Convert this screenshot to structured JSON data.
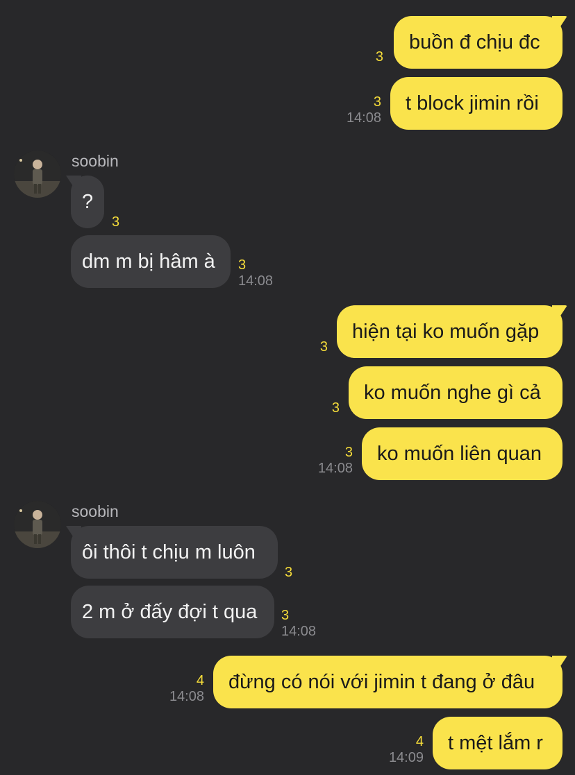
{
  "messages": [
    {
      "side": "me",
      "text": "buồn đ chịu đc",
      "count": "3",
      "time": ""
    },
    {
      "side": "me",
      "text": "t block jimin rồi",
      "count": "3",
      "time": "14:08"
    },
    {
      "side": "them",
      "sender": "soobin",
      "text": "?",
      "count": "3",
      "time": ""
    },
    {
      "side": "them",
      "text": "dm m bị hâm à",
      "count": "3",
      "time": "14:08"
    },
    {
      "side": "me",
      "text": "hiện tại ko muốn gặp",
      "count": "3",
      "time": ""
    },
    {
      "side": "me",
      "text": "ko muốn nghe gì cả",
      "count": "3",
      "time": ""
    },
    {
      "side": "me",
      "text": "ko muốn liên quan",
      "count": "3",
      "time": "14:08"
    },
    {
      "side": "them",
      "sender": "soobin",
      "text": "ôi thôi t chịu m luôn",
      "count": "3",
      "time": ""
    },
    {
      "side": "them",
      "text": "2 m ở đấy đợi t qua",
      "count": "3",
      "time": "14:08"
    },
    {
      "side": "me",
      "text": "đừng có nói với jimin t đang ở đâu",
      "count": "4",
      "time": "14:08"
    },
    {
      "side": "me",
      "text": "t mệt lắm r",
      "count": "4",
      "time": "14:09"
    }
  ],
  "colors": {
    "background": "#28282a",
    "my_bubble": "#fae34c",
    "their_bubble": "#3d3d40",
    "unread_count": "#f5dc3a",
    "timestamp": "#8b8b8f"
  },
  "icons": {
    "avatar": "avatar-photo-icon"
  }
}
